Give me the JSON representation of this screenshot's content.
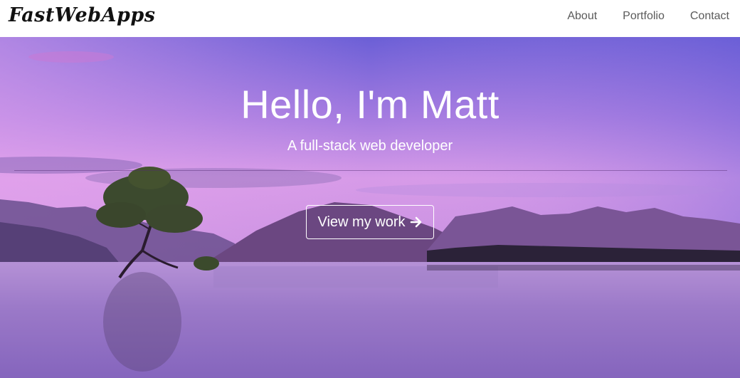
{
  "navbar": {
    "brand": "FastWebApps",
    "links": [
      {
        "label": "About"
      },
      {
        "label": "Portfolio"
      },
      {
        "label": "Contact"
      }
    ]
  },
  "hero": {
    "title": "Hello, I'm Matt",
    "subtitle": "A full-stack web developer",
    "cta_label": "View my work",
    "cta_icon": "arrow-right-icon"
  },
  "colors": {
    "sky_top": "#6e5fd8",
    "sky_mid": "#b07ae0",
    "horizon_pink": "#e7a3ea",
    "water": "#9a78c8",
    "mountains": "#5a4079",
    "text": "#ffffff",
    "nav_link": "#5a5a5a"
  }
}
